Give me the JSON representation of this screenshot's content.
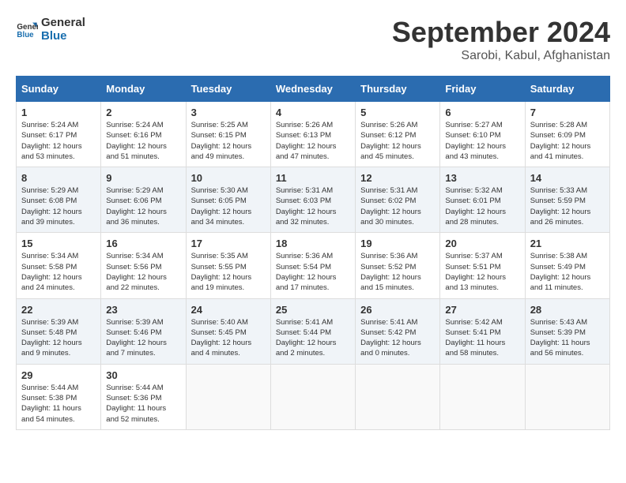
{
  "header": {
    "logo_line1": "General",
    "logo_line2": "Blue",
    "month": "September 2024",
    "location": "Sarobi, Kabul, Afghanistan"
  },
  "weekdays": [
    "Sunday",
    "Monday",
    "Tuesday",
    "Wednesday",
    "Thursday",
    "Friday",
    "Saturday"
  ],
  "weeks": [
    [
      {
        "day": "1",
        "sunrise": "5:24 AM",
        "sunset": "6:17 PM",
        "daylight": "12 hours and 53 minutes."
      },
      {
        "day": "2",
        "sunrise": "5:24 AM",
        "sunset": "6:16 PM",
        "daylight": "12 hours and 51 minutes."
      },
      {
        "day": "3",
        "sunrise": "5:25 AM",
        "sunset": "6:15 PM",
        "daylight": "12 hours and 49 minutes."
      },
      {
        "day": "4",
        "sunrise": "5:26 AM",
        "sunset": "6:13 PM",
        "daylight": "12 hours and 47 minutes."
      },
      {
        "day": "5",
        "sunrise": "5:26 AM",
        "sunset": "6:12 PM",
        "daylight": "12 hours and 45 minutes."
      },
      {
        "day": "6",
        "sunrise": "5:27 AM",
        "sunset": "6:10 PM",
        "daylight": "12 hours and 43 minutes."
      },
      {
        "day": "7",
        "sunrise": "5:28 AM",
        "sunset": "6:09 PM",
        "daylight": "12 hours and 41 minutes."
      }
    ],
    [
      {
        "day": "8",
        "sunrise": "5:29 AM",
        "sunset": "6:08 PM",
        "daylight": "12 hours and 39 minutes."
      },
      {
        "day": "9",
        "sunrise": "5:29 AM",
        "sunset": "6:06 PM",
        "daylight": "12 hours and 36 minutes."
      },
      {
        "day": "10",
        "sunrise": "5:30 AM",
        "sunset": "6:05 PM",
        "daylight": "12 hours and 34 minutes."
      },
      {
        "day": "11",
        "sunrise": "5:31 AM",
        "sunset": "6:03 PM",
        "daylight": "12 hours and 32 minutes."
      },
      {
        "day": "12",
        "sunrise": "5:31 AM",
        "sunset": "6:02 PM",
        "daylight": "12 hours and 30 minutes."
      },
      {
        "day": "13",
        "sunrise": "5:32 AM",
        "sunset": "6:01 PM",
        "daylight": "12 hours and 28 minutes."
      },
      {
        "day": "14",
        "sunrise": "5:33 AM",
        "sunset": "5:59 PM",
        "daylight": "12 hours and 26 minutes."
      }
    ],
    [
      {
        "day": "15",
        "sunrise": "5:34 AM",
        "sunset": "5:58 PM",
        "daylight": "12 hours and 24 minutes."
      },
      {
        "day": "16",
        "sunrise": "5:34 AM",
        "sunset": "5:56 PM",
        "daylight": "12 hours and 22 minutes."
      },
      {
        "day": "17",
        "sunrise": "5:35 AM",
        "sunset": "5:55 PM",
        "daylight": "12 hours and 19 minutes."
      },
      {
        "day": "18",
        "sunrise": "5:36 AM",
        "sunset": "5:54 PM",
        "daylight": "12 hours and 17 minutes."
      },
      {
        "day": "19",
        "sunrise": "5:36 AM",
        "sunset": "5:52 PM",
        "daylight": "12 hours and 15 minutes."
      },
      {
        "day": "20",
        "sunrise": "5:37 AM",
        "sunset": "5:51 PM",
        "daylight": "12 hours and 13 minutes."
      },
      {
        "day": "21",
        "sunrise": "5:38 AM",
        "sunset": "5:49 PM",
        "daylight": "12 hours and 11 minutes."
      }
    ],
    [
      {
        "day": "22",
        "sunrise": "5:39 AM",
        "sunset": "5:48 PM",
        "daylight": "12 hours and 9 minutes."
      },
      {
        "day": "23",
        "sunrise": "5:39 AM",
        "sunset": "5:46 PM",
        "daylight": "12 hours and 7 minutes."
      },
      {
        "day": "24",
        "sunrise": "5:40 AM",
        "sunset": "5:45 PM",
        "daylight": "12 hours and 4 minutes."
      },
      {
        "day": "25",
        "sunrise": "5:41 AM",
        "sunset": "5:44 PM",
        "daylight": "12 hours and 2 minutes."
      },
      {
        "day": "26",
        "sunrise": "5:41 AM",
        "sunset": "5:42 PM",
        "daylight": "12 hours and 0 minutes."
      },
      {
        "day": "27",
        "sunrise": "5:42 AM",
        "sunset": "5:41 PM",
        "daylight": "11 hours and 58 minutes."
      },
      {
        "day": "28",
        "sunrise": "5:43 AM",
        "sunset": "5:39 PM",
        "daylight": "11 hours and 56 minutes."
      }
    ],
    [
      {
        "day": "29",
        "sunrise": "5:44 AM",
        "sunset": "5:38 PM",
        "daylight": "11 hours and 54 minutes."
      },
      {
        "day": "30",
        "sunrise": "5:44 AM",
        "sunset": "5:36 PM",
        "daylight": "11 hours and 52 minutes."
      },
      null,
      null,
      null,
      null,
      null
    ]
  ]
}
